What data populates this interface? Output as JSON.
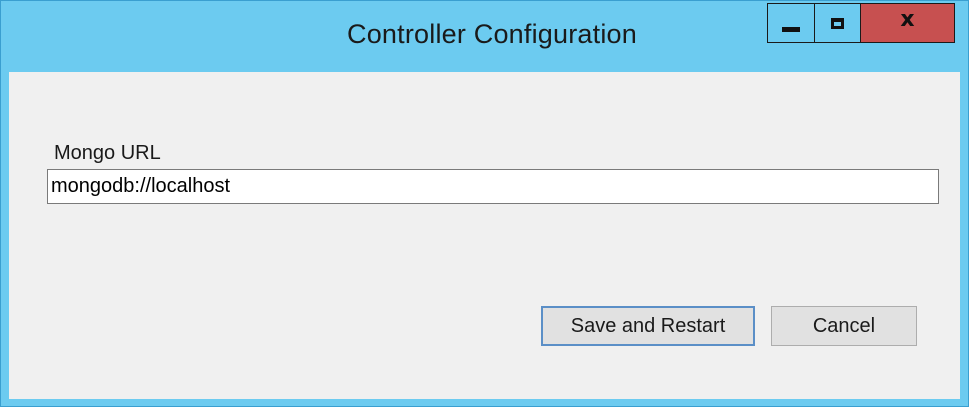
{
  "window": {
    "title": "Controller Configuration",
    "controls": {
      "minimize_icon": "minimize-icon",
      "maximize_icon": "maximize-icon",
      "close_glyph": "x"
    },
    "colors": {
      "title_bar": "#6ccbf0",
      "close_button": "#c75050",
      "client_background": "#f0f0f0",
      "default_button_border": "#5b8fc7"
    }
  },
  "form": {
    "mongo_url_label": "Mongo URL",
    "mongo_url_value": "mongodb://localhost"
  },
  "buttons": {
    "save_label": "Save and Restart",
    "cancel_label": "Cancel"
  }
}
